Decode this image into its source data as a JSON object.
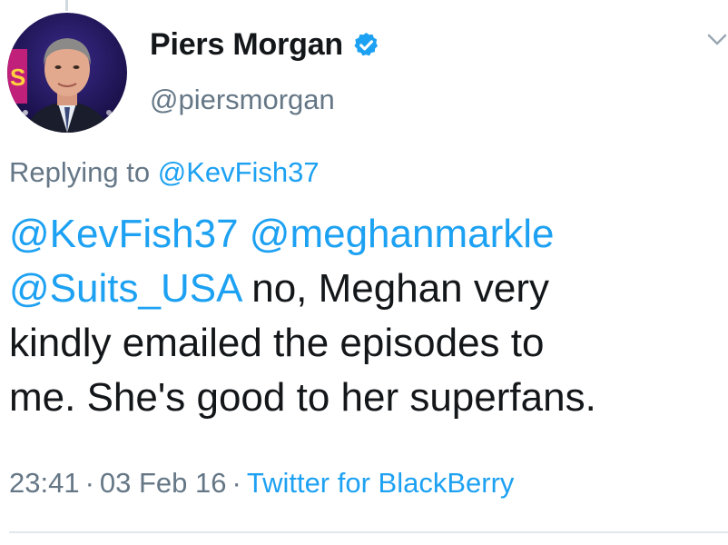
{
  "author": {
    "name": "Piers Morgan",
    "handle": "@piersmorgan",
    "avatar_icon": "user-photo-avatar",
    "verified_icon": "verified-badge-icon"
  },
  "reply": {
    "prefix": "Replying to",
    "to": "@KevFish37"
  },
  "tweet": {
    "line1": {
      "mention1": "@KevFish37",
      "mention2": "@meghanmarkle"
    },
    "line2": {
      "mention": "@Suits_USA",
      "text": "no, Meghan very"
    },
    "line3": "kindly emailed the episodes to",
    "line4": "me. She's good to her superfans."
  },
  "meta": {
    "time": "23:41",
    "separator": "·",
    "date": "03 Feb 16",
    "source": "Twitter for BlackBerry"
  },
  "colors": {
    "link": "#1da1f2",
    "secondary_text": "#657786",
    "primary_text": "#14171a"
  }
}
